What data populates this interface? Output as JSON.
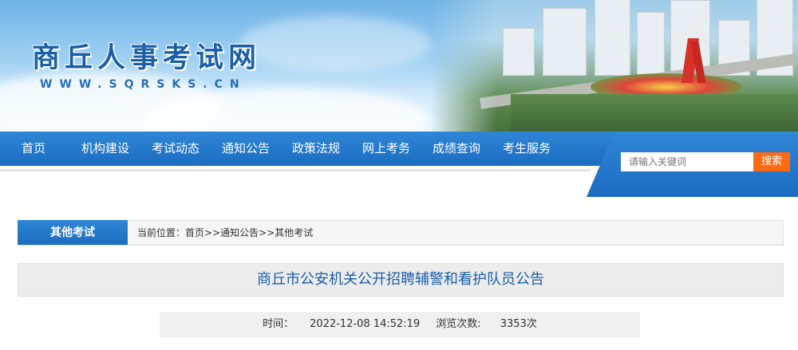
{
  "site": {
    "title": "商丘人事考试网",
    "url": "WWW.SQRSKS.CN"
  },
  "nav": {
    "items": [
      "首页",
      "机构建设",
      "考试动态",
      "通知公告",
      "政策法规",
      "网上考务",
      "成绩查询",
      "考生服务"
    ]
  },
  "search": {
    "placeholder": "请输入关键词",
    "button": "搜索"
  },
  "section": {
    "tab": "其他考试",
    "breadcrumb_prefix": "当前位置：",
    "breadcrumb": [
      "首页",
      ">>",
      "通知公告",
      ">>",
      "其他考试"
    ]
  },
  "article": {
    "title": "商丘市公安机关公开招聘辅警和看护队员公告",
    "time_label": "时间：",
    "time": "2022-12-08 14:52:19",
    "views_label": "浏览次数: ",
    "views": "3353次"
  },
  "colors": {
    "nav_blue": "#1b6cc0",
    "search_orange": "#ff6a13",
    "title_blue": "#1b5fa8"
  }
}
